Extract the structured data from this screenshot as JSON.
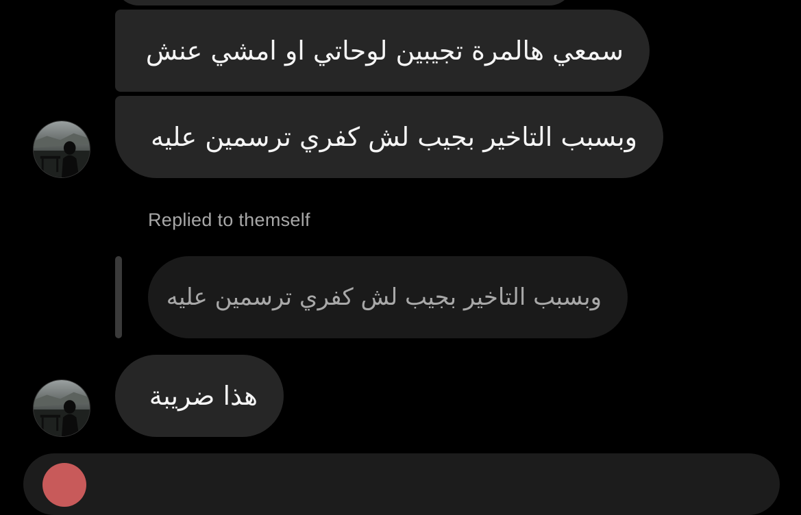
{
  "thread": {
    "messages": [
      {
        "text": "سمعي هالمرة تجيبين لوحاتي او امشي عنش"
      },
      {
        "text": "وبسبب التاخير بجيب لش كفري ترسمين عليه"
      }
    ],
    "reply": {
      "label": "Replied to themself",
      "quoted_text": "وبسبب التاخير بجيب لش كفري ترسمين عليه",
      "message": "هذا ضريبة"
    }
  },
  "colors": {
    "background": "#000000",
    "bubble": "#262626",
    "quoted_bubble": "#1a1a1a",
    "secondary_text": "#a8a8a8",
    "composer_avatar": "#c85a5a"
  }
}
